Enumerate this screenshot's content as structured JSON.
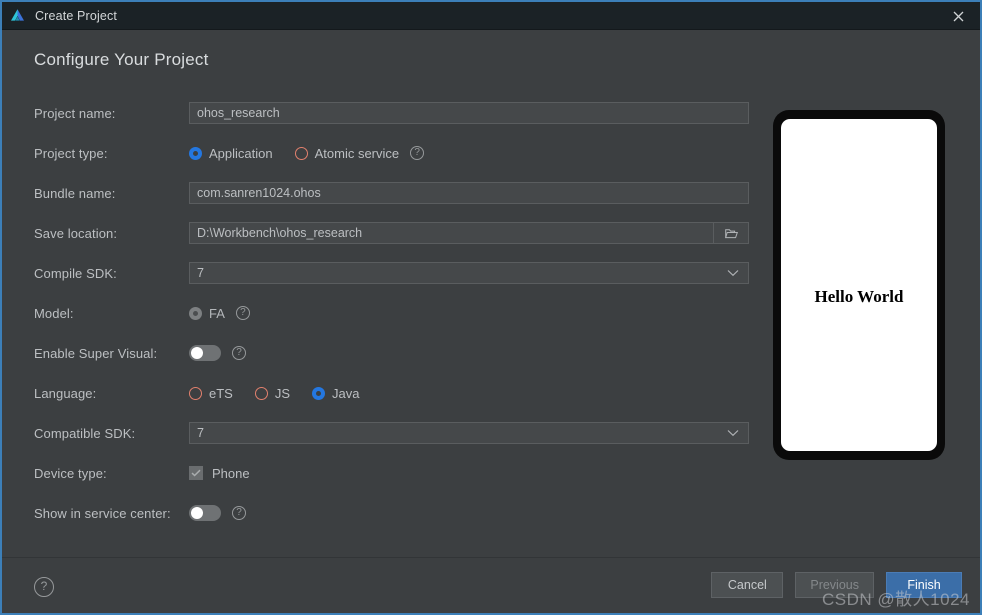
{
  "window": {
    "title": "Create Project",
    "logo_icon": "deveco-logo-icon",
    "close_icon": "close-icon",
    "accent_color": "#3c7fb8",
    "background_color": "#3c3f41",
    "titlebar_color": "#1b2226"
  },
  "page": {
    "heading": "Configure Your Project"
  },
  "fields": {
    "project_name": {
      "label": "Project name:",
      "value": "ohos_research",
      "placeholder": "Project name"
    },
    "project_type": {
      "label": "Project type:",
      "options": [
        {
          "label": "Application",
          "selected": true
        },
        {
          "label": "Atomic service",
          "selected": false
        }
      ],
      "help_icon": "help-icon"
    },
    "bundle_name": {
      "label": "Bundle name:",
      "value": "com.sanren1024.ohos",
      "placeholder": "Bundle name"
    },
    "save_location": {
      "label": "Save location:",
      "value": "D:\\Workbench\\ohos_research",
      "placeholder": "Save location",
      "browse_icon": "folder-open-icon"
    },
    "compile_sdk": {
      "label": "Compile SDK:",
      "value": "7",
      "arrow_icon": "chevron-down-icon"
    },
    "model": {
      "label": "Model:",
      "options": [
        {
          "label": "FA",
          "selected": true
        }
      ],
      "help_icon": "help-icon"
    },
    "enable_super_visual": {
      "label": "Enable Super Visual:",
      "checked": false,
      "help_icon": "help-icon"
    },
    "language": {
      "label": "Language:",
      "options": [
        {
          "label": "eTS",
          "selected": false
        },
        {
          "label": "JS",
          "selected": false
        },
        {
          "label": "Java",
          "selected": true
        }
      ]
    },
    "compatible_sdk": {
      "label": "Compatible SDK:",
      "value": "7",
      "arrow_icon": "chevron-down-icon"
    },
    "device_type": {
      "label": "Device type:",
      "options": [
        {
          "label": "Phone",
          "checked": true
        }
      ]
    },
    "show_in_service_center": {
      "label": "Show in service center:",
      "checked": false,
      "help_icon": "help-icon"
    }
  },
  "preview": {
    "screen_text": "Hello World"
  },
  "footer": {
    "help_icon": "help-icon",
    "cancel_label": "Cancel",
    "previous_label": "Previous",
    "finish_label": "Finish",
    "finish_color": "#3b6ea8"
  },
  "watermark": {
    "text": "CSDN @散人1024"
  }
}
